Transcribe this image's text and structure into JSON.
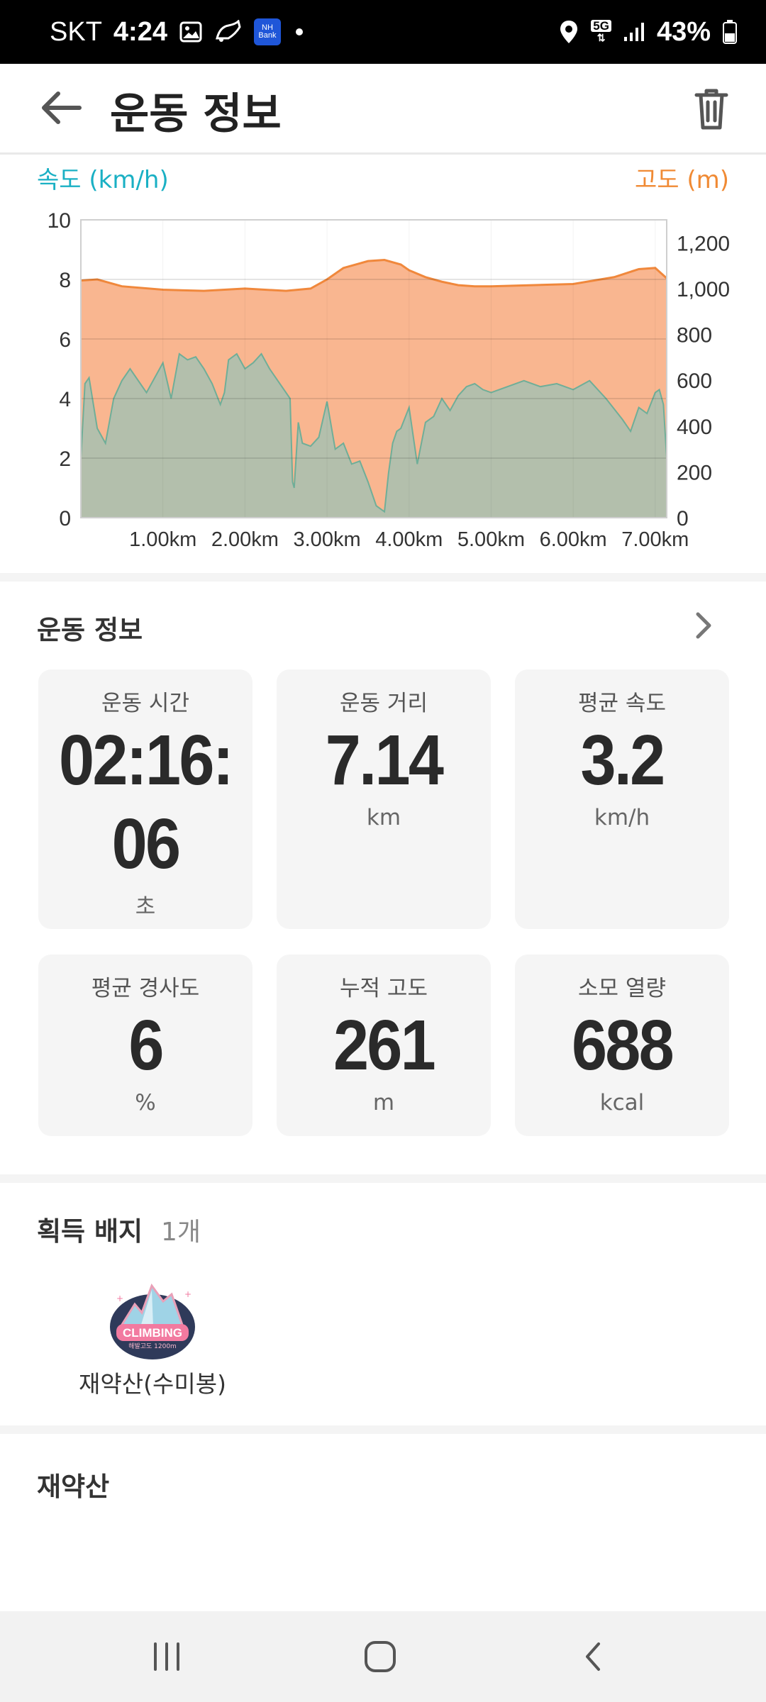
{
  "status_bar": {
    "carrier": "SKT",
    "time": "4:24",
    "nh_label": "NH",
    "nh_sub": "Bank",
    "network": "5G",
    "battery": "43%",
    "icons": [
      "gallery-icon",
      "shoe-icon",
      "nh-bank-icon",
      "dot-icon",
      "location-icon",
      "5g-icon",
      "signal-icon",
      "battery-icon"
    ]
  },
  "header": {
    "title": "운동 정보",
    "back_icon": "back-arrow-icon",
    "delete_icon": "trash-icon"
  },
  "chart_data": {
    "type": "area",
    "left_axis_title": "속도 (km/h)",
    "right_axis_title": "고도 (m)",
    "colors": {
      "speed": "#9bc2b6",
      "altitude": "#f9b690",
      "altitude_line": "#f0883c",
      "left_title": "#1ab0c4",
      "right_title": "#f08a34"
    },
    "x_ticks": [
      "1.00km",
      "2.00km",
      "3.00km",
      "4.00km",
      "5.00km",
      "6.00km",
      "7.00km"
    ],
    "x_range": [
      0,
      7.14
    ],
    "speed_ylim": [
      0,
      10
    ],
    "speed_ticks": [
      "0",
      "2",
      "4",
      "6",
      "8",
      "10"
    ],
    "altitude_ylim": [
      0,
      1300
    ],
    "altitude_ticks": [
      "0",
      "200",
      "400",
      "600",
      "800",
      "1,000",
      "1,200"
    ],
    "grid": true,
    "series": [
      {
        "axis": "right",
        "x": [
          0,
          0.2,
          0.5,
          1.0,
          1.5,
          2.0,
          2.5,
          2.8,
          3.0,
          3.2,
          3.5,
          3.7,
          3.9,
          4.0,
          4.2,
          4.4,
          4.6,
          4.8,
          5.0,
          5.5,
          6.0,
          6.5,
          6.8,
          7.0,
          7.14
        ],
        "values": [
          1035,
          1040,
          1010,
          995,
          990,
          1000,
          990,
          1000,
          1040,
          1090,
          1120,
          1125,
          1105,
          1080,
          1050,
          1030,
          1015,
          1010,
          1010,
          1015,
          1020,
          1050,
          1085,
          1090,
          1045
        ]
      },
      {
        "axis": "left",
        "x": [
          0,
          0.05,
          0.1,
          0.2,
          0.3,
          0.4,
          0.5,
          0.6,
          0.8,
          1.0,
          1.1,
          1.2,
          1.3,
          1.4,
          1.5,
          1.6,
          1.7,
          1.75,
          1.8,
          1.9,
          2.0,
          2.1,
          2.2,
          2.3,
          2.4,
          2.5,
          2.55,
          2.58,
          2.6,
          2.65,
          2.7,
          2.8,
          2.9,
          3.0,
          3.1,
          3.2,
          3.3,
          3.4,
          3.5,
          3.6,
          3.7,
          3.75,
          3.8,
          3.85,
          3.9,
          4.0,
          4.1,
          4.2,
          4.3,
          4.4,
          4.5,
          4.6,
          4.7,
          4.8,
          4.9,
          5.0,
          5.2,
          5.4,
          5.6,
          5.8,
          6.0,
          6.2,
          6.4,
          6.6,
          6.7,
          6.8,
          6.9,
          7.0,
          7.05,
          7.1,
          7.14
        ],
        "values": [
          2.0,
          4.5,
          4.7,
          3.0,
          2.5,
          4.0,
          4.6,
          5.0,
          4.2,
          5.2,
          4.0,
          5.5,
          5.3,
          5.4,
          5.0,
          4.5,
          3.8,
          4.2,
          5.3,
          5.5,
          5.0,
          5.2,
          5.5,
          5.0,
          4.6,
          4.2,
          4.0,
          1.2,
          1.0,
          3.2,
          2.5,
          2.4,
          2.7,
          3.9,
          2.3,
          2.5,
          1.8,
          1.9,
          1.2,
          0.4,
          0.2,
          1.5,
          2.5,
          2.9,
          3.0,
          3.7,
          1.8,
          3.2,
          3.4,
          4.0,
          3.6,
          4.1,
          4.4,
          4.5,
          4.3,
          4.2,
          4.4,
          4.6,
          4.4,
          4.5,
          4.3,
          4.6,
          4.0,
          3.3,
          2.9,
          3.7,
          3.5,
          4.2,
          4.3,
          3.8,
          2.0
        ]
      }
    ]
  },
  "exercise": {
    "section_title": "운동 정보",
    "chevron_icon": "chevron-right-icon",
    "cards": [
      {
        "label": "운동 시간",
        "value": "02:16:06",
        "unit": "초"
      },
      {
        "label": "운동 거리",
        "value": "7.14",
        "unit": "km"
      },
      {
        "label": "평균 속도",
        "value": "3.2",
        "unit": "km/h"
      },
      {
        "label": "평균 경사도",
        "value": "6",
        "unit": "%"
      },
      {
        "label": "누적 고도",
        "value": "261",
        "unit": "m"
      },
      {
        "label": "소모 열량",
        "value": "688",
        "unit": "kcal"
      }
    ]
  },
  "badges": {
    "section_title": "획득 배지",
    "count": "1개",
    "items": [
      {
        "name": "재약산(수미봉)",
        "badge_text": "CLIMBING",
        "badge_sub": "해발고도 1200m",
        "icon": "climbing-badge-icon"
      }
    ]
  },
  "mountain": {
    "title": "재약산"
  },
  "navbar": {
    "icons": [
      "recent-apps-icon",
      "home-icon",
      "back-icon"
    ]
  }
}
